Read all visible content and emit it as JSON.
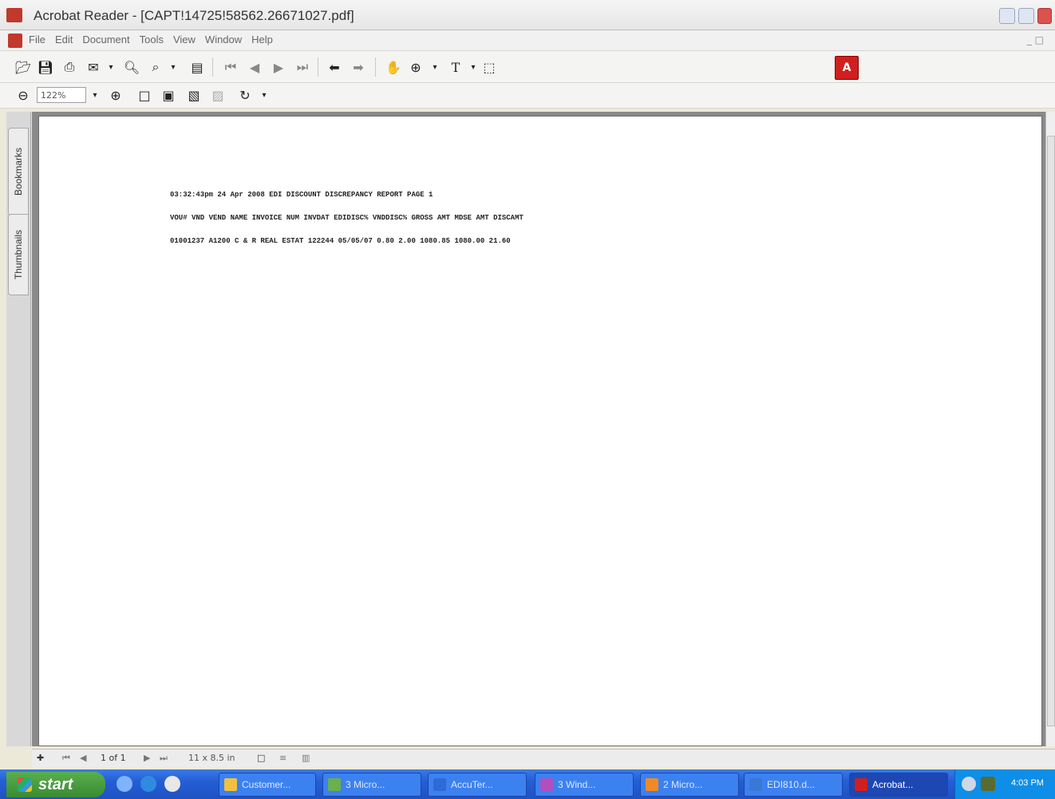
{
  "window": {
    "title": "Acrobat Reader - [CAPT!14725!58562.26671027.pdf]"
  },
  "menu": {
    "items": [
      "File",
      "Edit",
      "Document",
      "Tools",
      "View",
      "Window",
      "Help"
    ]
  },
  "toolbar": {
    "zoom": "122%"
  },
  "side_tabs": {
    "bookmarks": "Bookmarks",
    "thumbnails": "Thumbnails"
  },
  "report": {
    "header": "03:32:43pm  24 Apr 2008      EDI DISCOUNT DISCREPANCY REPORT     PAGE    1",
    "columns": "VOU#      VND      VEND NAME         INVOICE NUM         INVDAT EDIDISC%   VNDDISC%  GROSS AMT    MDSE AMT DISCAMT",
    "row": "01001237 A1200    C & R REAL ESTAT 122244          05/05/07    0.80      2.00     1080.85      1080.00   21.60"
  },
  "statusbar": {
    "page": "1 of 1",
    "size": "11 x 8.5 in"
  },
  "taskbar": {
    "start": "start",
    "tasks": [
      "Customer...",
      "3 Micro...",
      "AccuTer...",
      "3 Wind...",
      "2 Micro...",
      "EDI810.d...",
      "Acrobat..."
    ],
    "clock": "4:03 PM"
  },
  "colors": {
    "title_text": "#333333",
    "taskbar": "#245ed6",
    "start_button": "#3a8a33",
    "adobe_red": "#d01f1f"
  }
}
